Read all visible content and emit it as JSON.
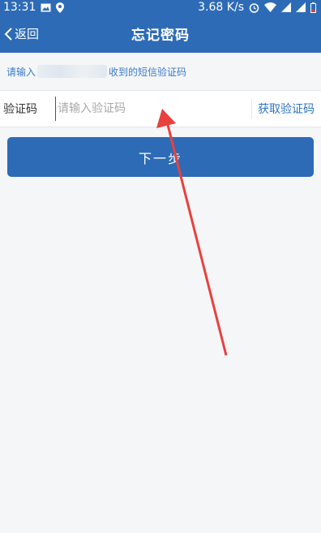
{
  "status_bar": {
    "time": "13:31",
    "net_speed": "3.68 K/s",
    "icons_left": [
      "image-icon",
      "location-pin-icon"
    ],
    "icons_right": [
      "alarm-icon",
      "wifi-icon",
      "signal-icon",
      "signal-icon",
      "battery-icon"
    ]
  },
  "nav": {
    "back_label": "返回",
    "title": "忘记密码"
  },
  "hint": {
    "prefix": "请输入",
    "suffix": "收到的短信验证码"
  },
  "verify_row": {
    "label": "验证码",
    "placeholder": "请输入验证码",
    "value": "",
    "get_code_label": "获取验证码"
  },
  "next_button": {
    "label": "下一步"
  },
  "colors": {
    "primary": "#2e6bb6",
    "link": "#2e74c4",
    "background": "#f4f6f8",
    "annotation_arrow": "#e8413d"
  }
}
